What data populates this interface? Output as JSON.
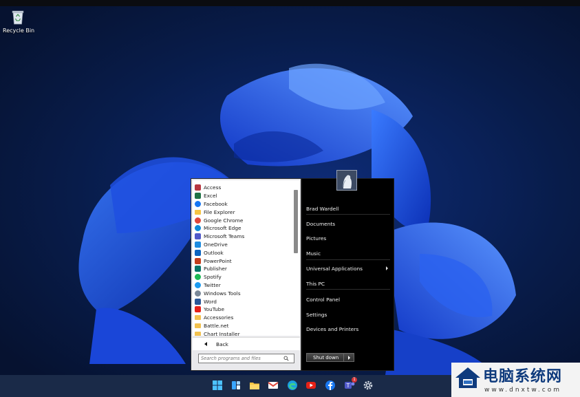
{
  "desktop": {
    "recycle_bin_label": "Recycle Bin"
  },
  "start_menu": {
    "programs": [
      {
        "label": "Access",
        "icon": "access-icon",
        "color": "#b7363f"
      },
      {
        "label": "Excel",
        "icon": "excel-icon",
        "color": "#1f7244"
      },
      {
        "label": "Facebook",
        "icon": "facebook-icon",
        "color": "#1877f2"
      },
      {
        "label": "File Explorer",
        "icon": "folder-icon",
        "color": "#f6c543"
      },
      {
        "label": "Google Chrome",
        "icon": "chrome-icon",
        "color": "#e0463b"
      },
      {
        "label": "Microsoft Edge",
        "icon": "edge-icon",
        "color": "#0f8ad8"
      },
      {
        "label": "Microsoft Teams",
        "icon": "teams-icon",
        "color": "#5059c9"
      },
      {
        "label": "OneDrive",
        "icon": "onedrive-icon",
        "color": "#1d8ce0"
      },
      {
        "label": "Outlook",
        "icon": "outlook-icon",
        "color": "#0b64c0"
      },
      {
        "label": "PowerPoint",
        "icon": "powerpoint-icon",
        "color": "#c43e1c"
      },
      {
        "label": "Publisher",
        "icon": "publisher-icon",
        "color": "#077568"
      },
      {
        "label": "Spotify",
        "icon": "spotify-icon",
        "color": "#1db954"
      },
      {
        "label": "Twitter",
        "icon": "twitter-icon",
        "color": "#1d9bf0"
      },
      {
        "label": "Windows Tools",
        "icon": "gear-icon",
        "color": "#7a8898"
      },
      {
        "label": "Word",
        "icon": "word-icon",
        "color": "#2b5797"
      },
      {
        "label": "YouTube",
        "icon": "youtube-icon",
        "color": "#e62117"
      },
      {
        "label": "Accessories",
        "icon": "folder-icon",
        "color": "#f2c14e"
      },
      {
        "label": "Battle.net",
        "icon": "folder-icon",
        "color": "#f2c14e"
      },
      {
        "label": "Chart Installer",
        "icon": "folder-icon",
        "color": "#f2c14e"
      }
    ],
    "back_label": "Back",
    "search_placeholder": "Search programs and files",
    "right_items": [
      {
        "label": "Brad Wardell"
      },
      {
        "label": "Documents"
      },
      {
        "label": "Pictures"
      },
      {
        "label": "Music"
      },
      {
        "label": "Universal Applications",
        "submenu": true
      },
      {
        "label": "This PC"
      },
      {
        "label": "Control Panel"
      },
      {
        "label": "Settings"
      },
      {
        "label": "Devices and Printers"
      }
    ],
    "shutdown_label": "Shut down"
  },
  "taskbar": {
    "icons": [
      "windows-start-icon",
      "widgets-icon",
      "file-explorer-icon",
      "gmail-icon",
      "edge-icon",
      "youtube-icon",
      "facebook-icon",
      "teams-icon",
      "settings-gear-icon"
    ],
    "teams_badge": "1"
  },
  "watermark": {
    "title": "电脑系统网",
    "url": "www.dnxtw.com"
  }
}
